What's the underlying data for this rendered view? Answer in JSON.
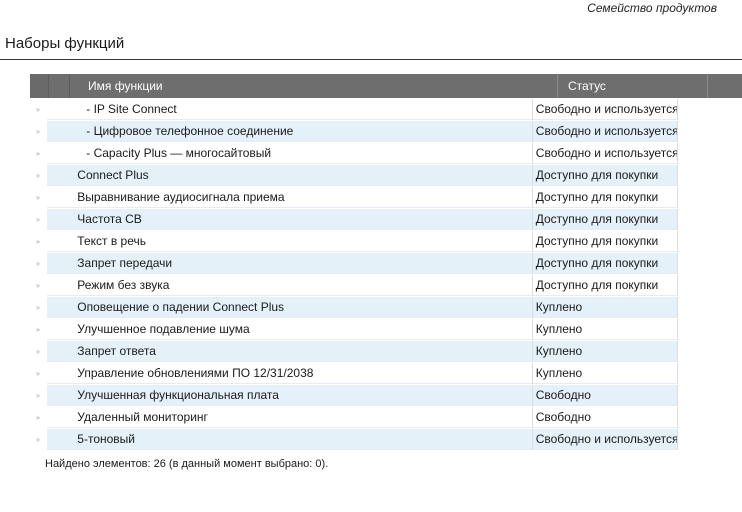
{
  "header": {
    "product_family_link": "Семейство продуктов",
    "title": "Наборы функций"
  },
  "table": {
    "columns": {
      "name": "Имя функции",
      "status": "Статус"
    },
    "rows": [
      {
        "name": "- IP Site Connect",
        "status": "Свободно и используется",
        "sub": true
      },
      {
        "name": "- Цифровое телефонное соединение",
        "status": "Свободно и используется",
        "sub": true
      },
      {
        "name": "- Capacity Plus — многосайтовый",
        "status": "Свободно и используется",
        "sub": true
      },
      {
        "name": "Connect Plus",
        "status": "Доступно для покупки"
      },
      {
        "name": "Выравнивание аудиосигнала приема",
        "status": "Доступно для покупки"
      },
      {
        "name": "Частота CB",
        "status": "Доступно для покупки"
      },
      {
        "name": "Текст в речь",
        "status": "Доступно для покупки"
      },
      {
        "name": "Запрет передачи",
        "status": "Доступно для покупки"
      },
      {
        "name": "Режим без звука",
        "status": "Доступно для покупки"
      },
      {
        "name": "Оповещение о падении Connect Plus",
        "status": "Куплено"
      },
      {
        "name": "Улучшенное подавление шума",
        "status": "Куплено"
      },
      {
        "name": "Запрет ответа",
        "status": "Куплено"
      },
      {
        "name": "Управление обновлениями ПО 12/31/2038",
        "status": "Куплено"
      },
      {
        "name": "Улучшенная функциональная плата",
        "status": "Свободно"
      },
      {
        "name": "Удаленный мониторинг",
        "status": "Свободно"
      },
      {
        "name": "5-тоновый",
        "status": "Свободно и используется"
      }
    ]
  },
  "footer": {
    "count_text": "Найдено элементов: 26 (в данный момент выбрано: 0)."
  },
  "colors": {
    "header_bg": "#6e6e6e",
    "row_alt_bg": "#e4f1f8",
    "row_bg": "#ffffff"
  }
}
